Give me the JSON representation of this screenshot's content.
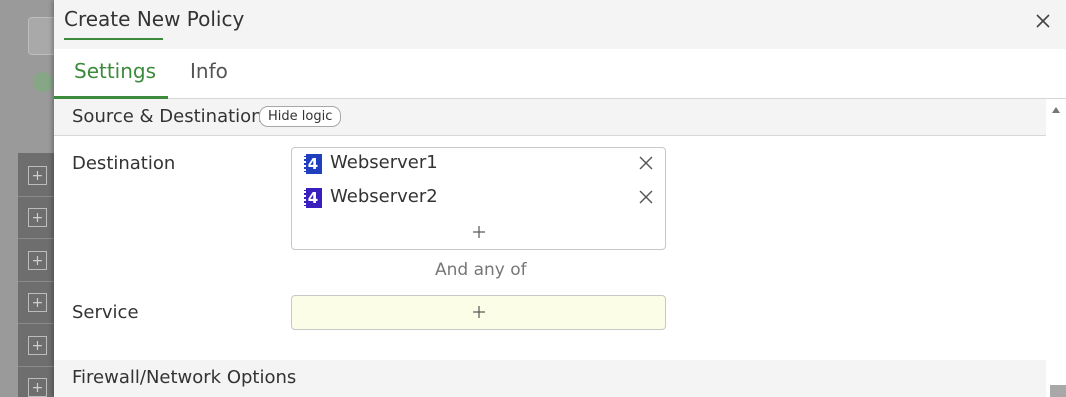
{
  "dialog": {
    "title": "Create New Policy"
  },
  "tabs": [
    {
      "label": "Settings",
      "active": true
    },
    {
      "label": "Info",
      "active": false
    }
  ],
  "section_source_destination": {
    "title": "Source & Destination",
    "hide_logic_label": "Hide logic"
  },
  "destination": {
    "label": "Destination",
    "entries": [
      {
        "name": "Webserver1",
        "icon": "ipv4-address-icon",
        "icon_glyph": "4",
        "icon_color": "#1f3fbf"
      },
      {
        "name": "Webserver2",
        "icon": "ipv4-address-icon",
        "icon_glyph": "4",
        "icon_color": "#3a1fbf"
      }
    ]
  },
  "connector_text": "And any of",
  "service": {
    "label": "Service"
  },
  "section_firewall": {
    "title": "Firewall/Network Options"
  },
  "colors": {
    "accent": "#3c8a3c",
    "service_field_bg": "#fcfde7"
  }
}
